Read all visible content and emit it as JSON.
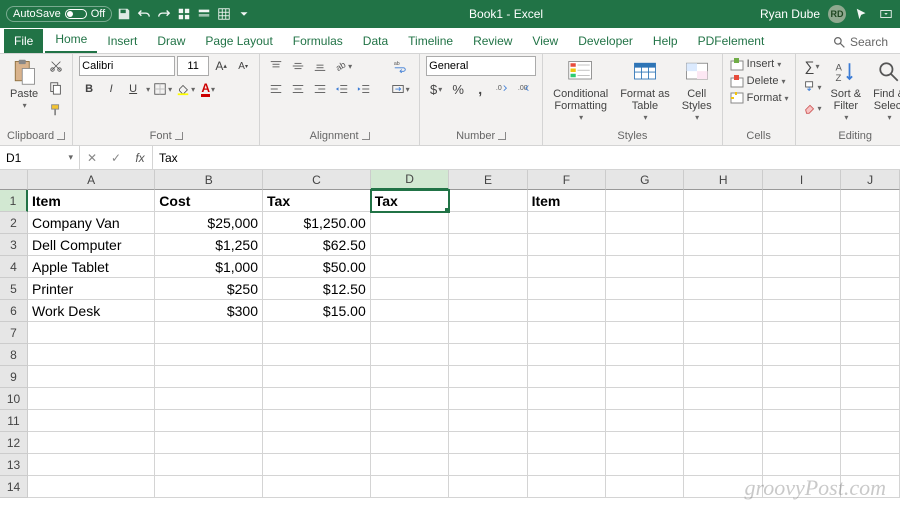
{
  "titlebar": {
    "autosave_label": "AutoSave",
    "autosave_state": "Off",
    "title": "Book1 - Excel",
    "username": "Ryan Dube",
    "initials": "RD"
  },
  "tabs": {
    "file": "File",
    "home": "Home",
    "insert": "Insert",
    "draw": "Draw",
    "page_layout": "Page Layout",
    "formulas": "Formulas",
    "data": "Data",
    "timeline": "Timeline",
    "review": "Review",
    "view": "View",
    "developer": "Developer",
    "help": "Help",
    "pdfelement": "PDFelement",
    "search": "Search"
  },
  "ribbon": {
    "clipboard": {
      "label": "Clipboard",
      "paste": "Paste"
    },
    "font": {
      "label": "Font",
      "family": "Calibri",
      "size": "11",
      "bold": "B",
      "italic": "I",
      "underline": "U"
    },
    "alignment": {
      "label": "Alignment"
    },
    "number": {
      "label": "Number",
      "format": "General"
    },
    "styles": {
      "label": "Styles",
      "conditional": "Conditional\nFormatting",
      "format_table": "Format as\nTable",
      "cell_styles": "Cell\nStyles"
    },
    "cells": {
      "label": "Cells",
      "insert": "Insert",
      "delete": "Delete",
      "format": "Format"
    },
    "editing": {
      "label": "Editing",
      "sort": "Sort &\nFilter",
      "find": "Find &\nSelect"
    }
  },
  "formula_bar": {
    "cell_ref": "D1",
    "value": "Tax"
  },
  "columns": [
    "A",
    "B",
    "C",
    "D",
    "E",
    "F",
    "G",
    "H",
    "I",
    "J"
  ],
  "rows": [
    "1",
    "2",
    "3",
    "4",
    "5",
    "6",
    "7",
    "8",
    "9",
    "10",
    "11",
    "12",
    "13",
    "14"
  ],
  "active_col": "D",
  "active_row": "1",
  "sheet": {
    "r1": {
      "A": "Item",
      "B": "Cost",
      "C": "Tax",
      "D": "Tax",
      "E": "",
      "F": "Item"
    },
    "r2": {
      "A": "Company Van",
      "B": "$25,000",
      "C": "$1,250.00"
    },
    "r3": {
      "A": "Dell Computer",
      "B": "$1,250",
      "C": "$62.50"
    },
    "r4": {
      "A": "Apple Tablet",
      "B": "$1,000",
      "C": "$50.00"
    },
    "r5": {
      "A": "Printer",
      "B": "$250",
      "C": "$12.50"
    },
    "r6": {
      "A": "Work Desk",
      "B": "$300",
      "C": "$15.00"
    }
  },
  "watermark": "groovyPost.com"
}
